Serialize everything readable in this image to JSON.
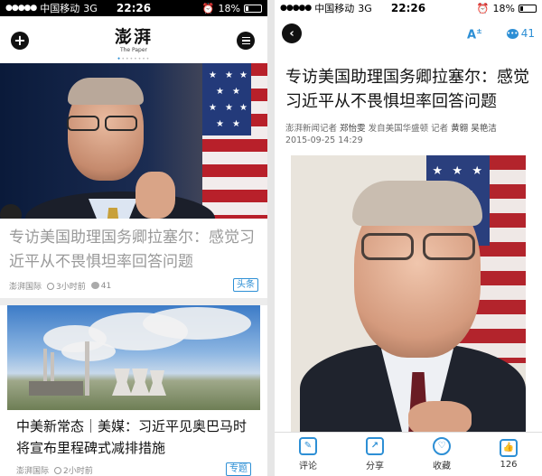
{
  "status_left": {
    "carrier": "中国移动",
    "network": "3G",
    "time": "22:26",
    "battery": "18%"
  },
  "status_right": {
    "carrier": "中国移动",
    "network": "3G",
    "time": "22:26",
    "battery": "18%"
  },
  "feed": {
    "logo": "澎湃",
    "logo_sub": "The Paper",
    "page_dots": [
      "•",
      "•",
      "•",
      "•",
      "•",
      "•",
      "•",
      "•"
    ],
    "articles": [
      {
        "title": "专访美国助理国务卿拉塞尔：感觉习近平从不畏惧坦率回答问题",
        "source": "澎湃国际",
        "time": "3小时前",
        "comments": "41",
        "tag": "头条"
      },
      {
        "title": "中美新常态｜美媒：习近平见奥巴马时将宣布里程碑式减排措施",
        "source": "澎湃国际",
        "time": "2小时前",
        "tag": "专题"
      }
    ]
  },
  "article": {
    "font_button": "A",
    "comment_count": "41",
    "title": "专访美国助理国务卿拉塞尔：感觉习近平从不畏惧坦率回答问题",
    "byline_prefix": "澎湃新闻记者",
    "byline_reporter": "郑怡雯",
    "byline_mid": "发自美国华盛顿 记者",
    "byline_reporter2": "黄翱",
    "byline_reporter3": "吴艳洁",
    "date": "2015-09-25 14:29",
    "bottom_bar": [
      {
        "label": "评论",
        "icon": "comment-icon"
      },
      {
        "label": "分享",
        "icon": "share-icon"
      },
      {
        "label": "收藏",
        "icon": "heart-icon"
      },
      {
        "label": "126",
        "icon": "thumbs-up-icon"
      }
    ]
  },
  "colors": {
    "accent": "#2d8fd5",
    "statusbar_dark": "#000000"
  }
}
